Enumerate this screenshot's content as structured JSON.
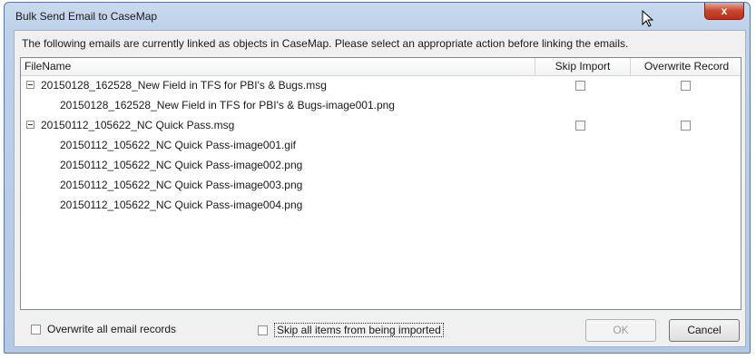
{
  "window": {
    "title": "Bulk Send Email to CaseMap",
    "close_glyph": "x"
  },
  "dialog": {
    "instructions": "The following emails are currently linked as objects in CaseMap. Please select an appropriate action before linking the emails."
  },
  "grid": {
    "columns": {
      "filename": "FileName",
      "skip_import": "Skip Import",
      "overwrite_record": "Overwrite Record"
    },
    "rows": [
      {
        "name": "20150128_162528_New Field in TFS for PBI's & Bugs.msg",
        "level": 0,
        "expandable": true,
        "skip_import": false,
        "overwrite_record": false
      },
      {
        "name": "20150128_162528_New Field in TFS for PBI's & Bugs-image001.png",
        "level": 1,
        "expandable": false
      },
      {
        "name": "20150112_105622_NC Quick Pass.msg",
        "level": 0,
        "expandable": true,
        "skip_import": false,
        "overwrite_record": false
      },
      {
        "name": "20150112_105622_NC Quick Pass-image001.gif",
        "level": 1,
        "expandable": false
      },
      {
        "name": "20150112_105622_NC Quick Pass-image002.png",
        "level": 1,
        "expandable": false
      },
      {
        "name": "20150112_105622_NC Quick Pass-image003.png",
        "level": 1,
        "expandable": false
      },
      {
        "name": "20150112_105622_NC Quick Pass-image004.png",
        "level": 1,
        "expandable": false
      }
    ]
  },
  "options": {
    "overwrite_all_label": "Overwrite all email records",
    "overwrite_all_checked": false,
    "skip_all_label": "Skip all items from being imported",
    "skip_all_checked": false
  },
  "buttons": {
    "ok_label": "OK",
    "ok_enabled": false,
    "cancel_label": "Cancel"
  }
}
